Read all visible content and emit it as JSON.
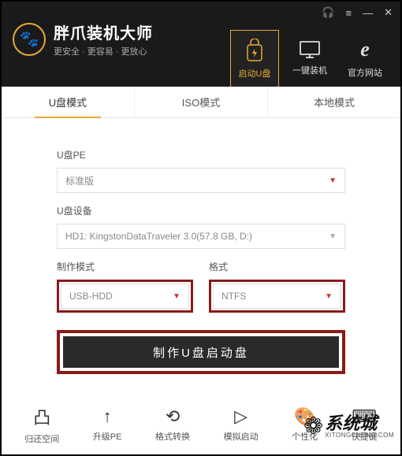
{
  "titlebar": {
    "headset": "🎧",
    "menu": "≡",
    "min": "—",
    "close": "✕"
  },
  "brand": {
    "title": "胖爪装机大师",
    "subtitle": "更安全 · 更容易 · 更放心",
    "paw": "🐾"
  },
  "nav": [
    {
      "label": "启动U盘",
      "icon": "⚡"
    },
    {
      "label": "一键装机",
      "icon": "🖥"
    },
    {
      "label": "官方网站",
      "icon": "e"
    }
  ],
  "tabs": [
    {
      "label": "U盘模式"
    },
    {
      "label": "ISO模式"
    },
    {
      "label": "本地模式"
    }
  ],
  "form": {
    "pe_label": "U盘PE",
    "pe_value": "标准版",
    "device_label": "U盘设备",
    "device_value": "HD1: KingstonDataTraveler 3.0(57.8 GB, D:)",
    "mode_label": "制作模式",
    "mode_value": "USB-HDD",
    "format_label": "格式",
    "format_value": "NTFS",
    "main_button": "制作U盘启动盘"
  },
  "bottom": [
    {
      "label": "归还空间",
      "icon": "📦"
    },
    {
      "label": "升级PE",
      "icon": "⬆"
    },
    {
      "label": "格式转换",
      "icon": "🔄"
    },
    {
      "label": "模拟启动",
      "icon": "▶"
    },
    {
      "label": "个性化",
      "icon": "🎨"
    },
    {
      "label": "快捷键",
      "icon": "⌨"
    }
  ],
  "watermark": {
    "main": "系统城",
    "sub": "XITONGCHENG.COM",
    "icon": "⚙"
  }
}
